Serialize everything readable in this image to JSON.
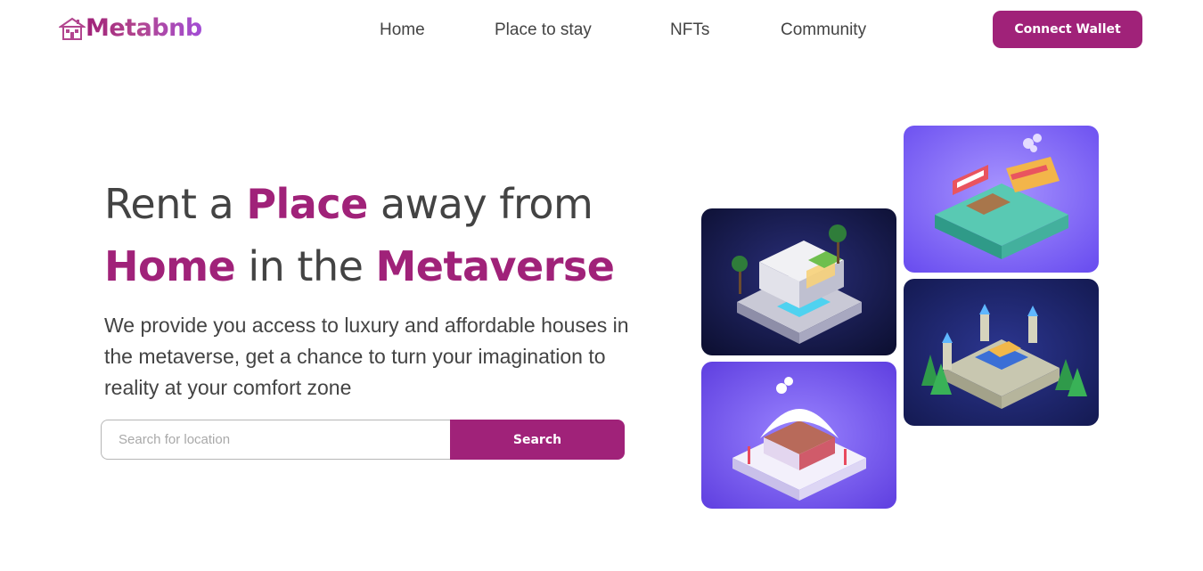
{
  "brand": {
    "name": "Metabnb",
    "logo_icon": "house-icon",
    "accent_color": "#a02279"
  },
  "nav": {
    "items": [
      {
        "label": "Home"
      },
      {
        "label": "Place to stay"
      },
      {
        "label": "NFTs"
      },
      {
        "label": "Community"
      }
    ],
    "cta_label": "Connect Wallet"
  },
  "hero": {
    "title": {
      "part1": "Rent a ",
      "accent1": "Place",
      "part2": " away from",
      "accent2": "Home",
      "part3": " in the ",
      "accent3": "Metaverse"
    },
    "description": "We provide you access to luxury and affordable houses in the metaverse, get a chance to turn your imagination to reality at your comfort zone",
    "search": {
      "placeholder": "Search for location",
      "value": "",
      "button_label": "Search"
    }
  },
  "gallery": [
    {
      "name": "modern-villa-image",
      "theme": "dark-navy"
    },
    {
      "name": "snow-cabin-image",
      "theme": "violet"
    },
    {
      "name": "market-stall-image",
      "theme": "violet"
    },
    {
      "name": "castle-image",
      "theme": "dark-navy"
    }
  ]
}
